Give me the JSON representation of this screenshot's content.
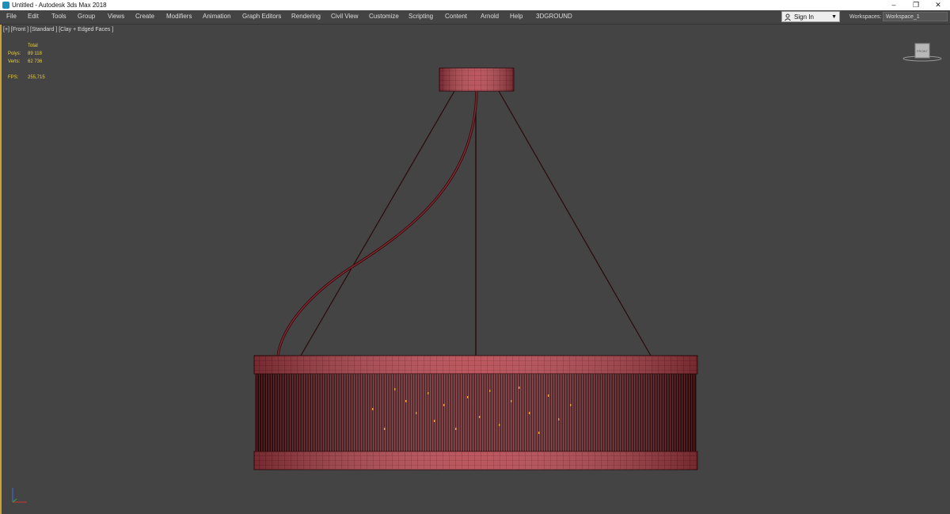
{
  "window": {
    "title": "Untitled - Autodesk 3ds Max 2018",
    "controls": [
      "–",
      "❐",
      "✕"
    ]
  },
  "menu": [
    "File",
    "Edit",
    "Tools",
    "Group",
    "Views",
    "Create",
    "Modifiers",
    "Animation",
    "Graph Editors",
    "Rendering",
    "Civil View",
    "Customize",
    "Scripting",
    "Content",
    "Arnold",
    "Help",
    "3DGROUND"
  ],
  "account": {
    "sign_in": "Sign In",
    "workspaces_label": "Workspaces:",
    "workspace": "Workspace_1"
  },
  "viewport": {
    "label": "[+] [Front ] [Standard ] [Clay + Edged Faces ]",
    "stats": {
      "total_label": "Total",
      "polys_label": "Polys:",
      "polys": "89 118",
      "verts_label": "Verts:",
      "verts": "62 736",
      "fps_label": "FPS:",
      "fps": "255,715"
    },
    "viewcube_face": "FRONT"
  },
  "colors": {
    "background": "#444444",
    "mesh": "#b3414a",
    "mesh_dark": "#3a0d10",
    "active_border": "#c8a233",
    "stats": "#e8d040"
  }
}
